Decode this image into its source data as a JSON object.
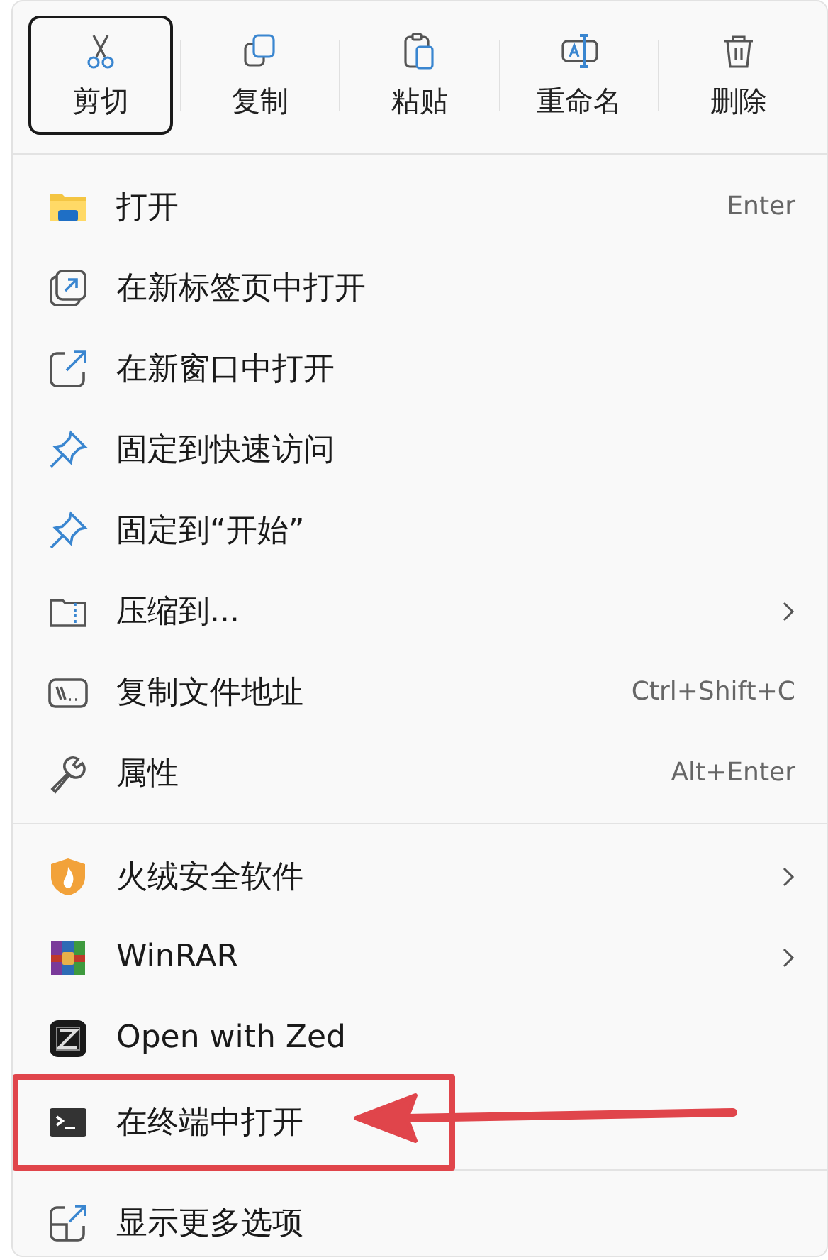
{
  "toolbar": [
    {
      "label": "剪切",
      "selected": true
    },
    {
      "label": "复制",
      "selected": false
    },
    {
      "label": "粘贴",
      "selected": false
    },
    {
      "label": "重命名",
      "selected": false
    },
    {
      "label": "删除",
      "selected": false
    }
  ],
  "sections": [
    {
      "items": [
        {
          "label": "打开",
          "shortcut": "Enter",
          "submenu": false,
          "annotated": false
        },
        {
          "label": "在新标签页中打开",
          "submenu": false,
          "annotated": false
        },
        {
          "label": "在新窗口中打开",
          "submenu": false,
          "annotated": false
        },
        {
          "label": "固定到快速访问",
          "submenu": false,
          "annotated": false
        },
        {
          "label": "固定到“开始”",
          "submenu": false,
          "annotated": false
        },
        {
          "label": "压缩到...",
          "submenu": true,
          "annotated": false
        },
        {
          "label": "复制文件地址",
          "shortcut": "Ctrl+Shift+C",
          "submenu": false,
          "annotated": false
        },
        {
          "label": "属性",
          "shortcut": "Alt+Enter",
          "submenu": false,
          "annotated": false
        }
      ]
    },
    {
      "items": [
        {
          "label": "火绒安全软件",
          "submenu": true,
          "annotated": false
        },
        {
          "label": "WinRAR",
          "submenu": true,
          "annotated": false
        },
        {
          "label": "Open with Zed",
          "submenu": false,
          "annotated": false
        },
        {
          "label": "在终端中打开",
          "submenu": false,
          "annotated": true
        }
      ]
    },
    {
      "items": [
        {
          "label": "显示更多选项",
          "submenu": false,
          "annotated": false
        }
      ]
    }
  ]
}
